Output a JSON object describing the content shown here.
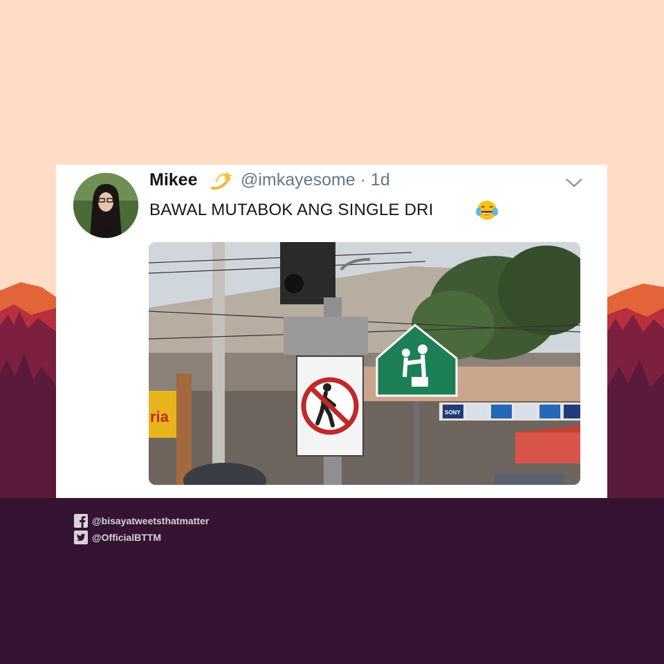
{
  "tweet": {
    "display_name": "Mikee",
    "handle_line": "@imkayesome · 1d",
    "text": "BAWAL MUTABOK ANG SINGLE DRI",
    "name_emoji": "dizzy-emoji",
    "text_emoji": "tears-of-joy-emoji"
  },
  "photo": {
    "sign_text": "ria",
    "store_banner": "SONY"
  },
  "footer": {
    "facebook": "@bisayatweetsthatmatter",
    "twitter": "@OfficialBTTM"
  },
  "colors": {
    "sky": "#ffdcc4",
    "ground": "#341432",
    "card": "#ffffff",
    "handle": "#657786"
  }
}
